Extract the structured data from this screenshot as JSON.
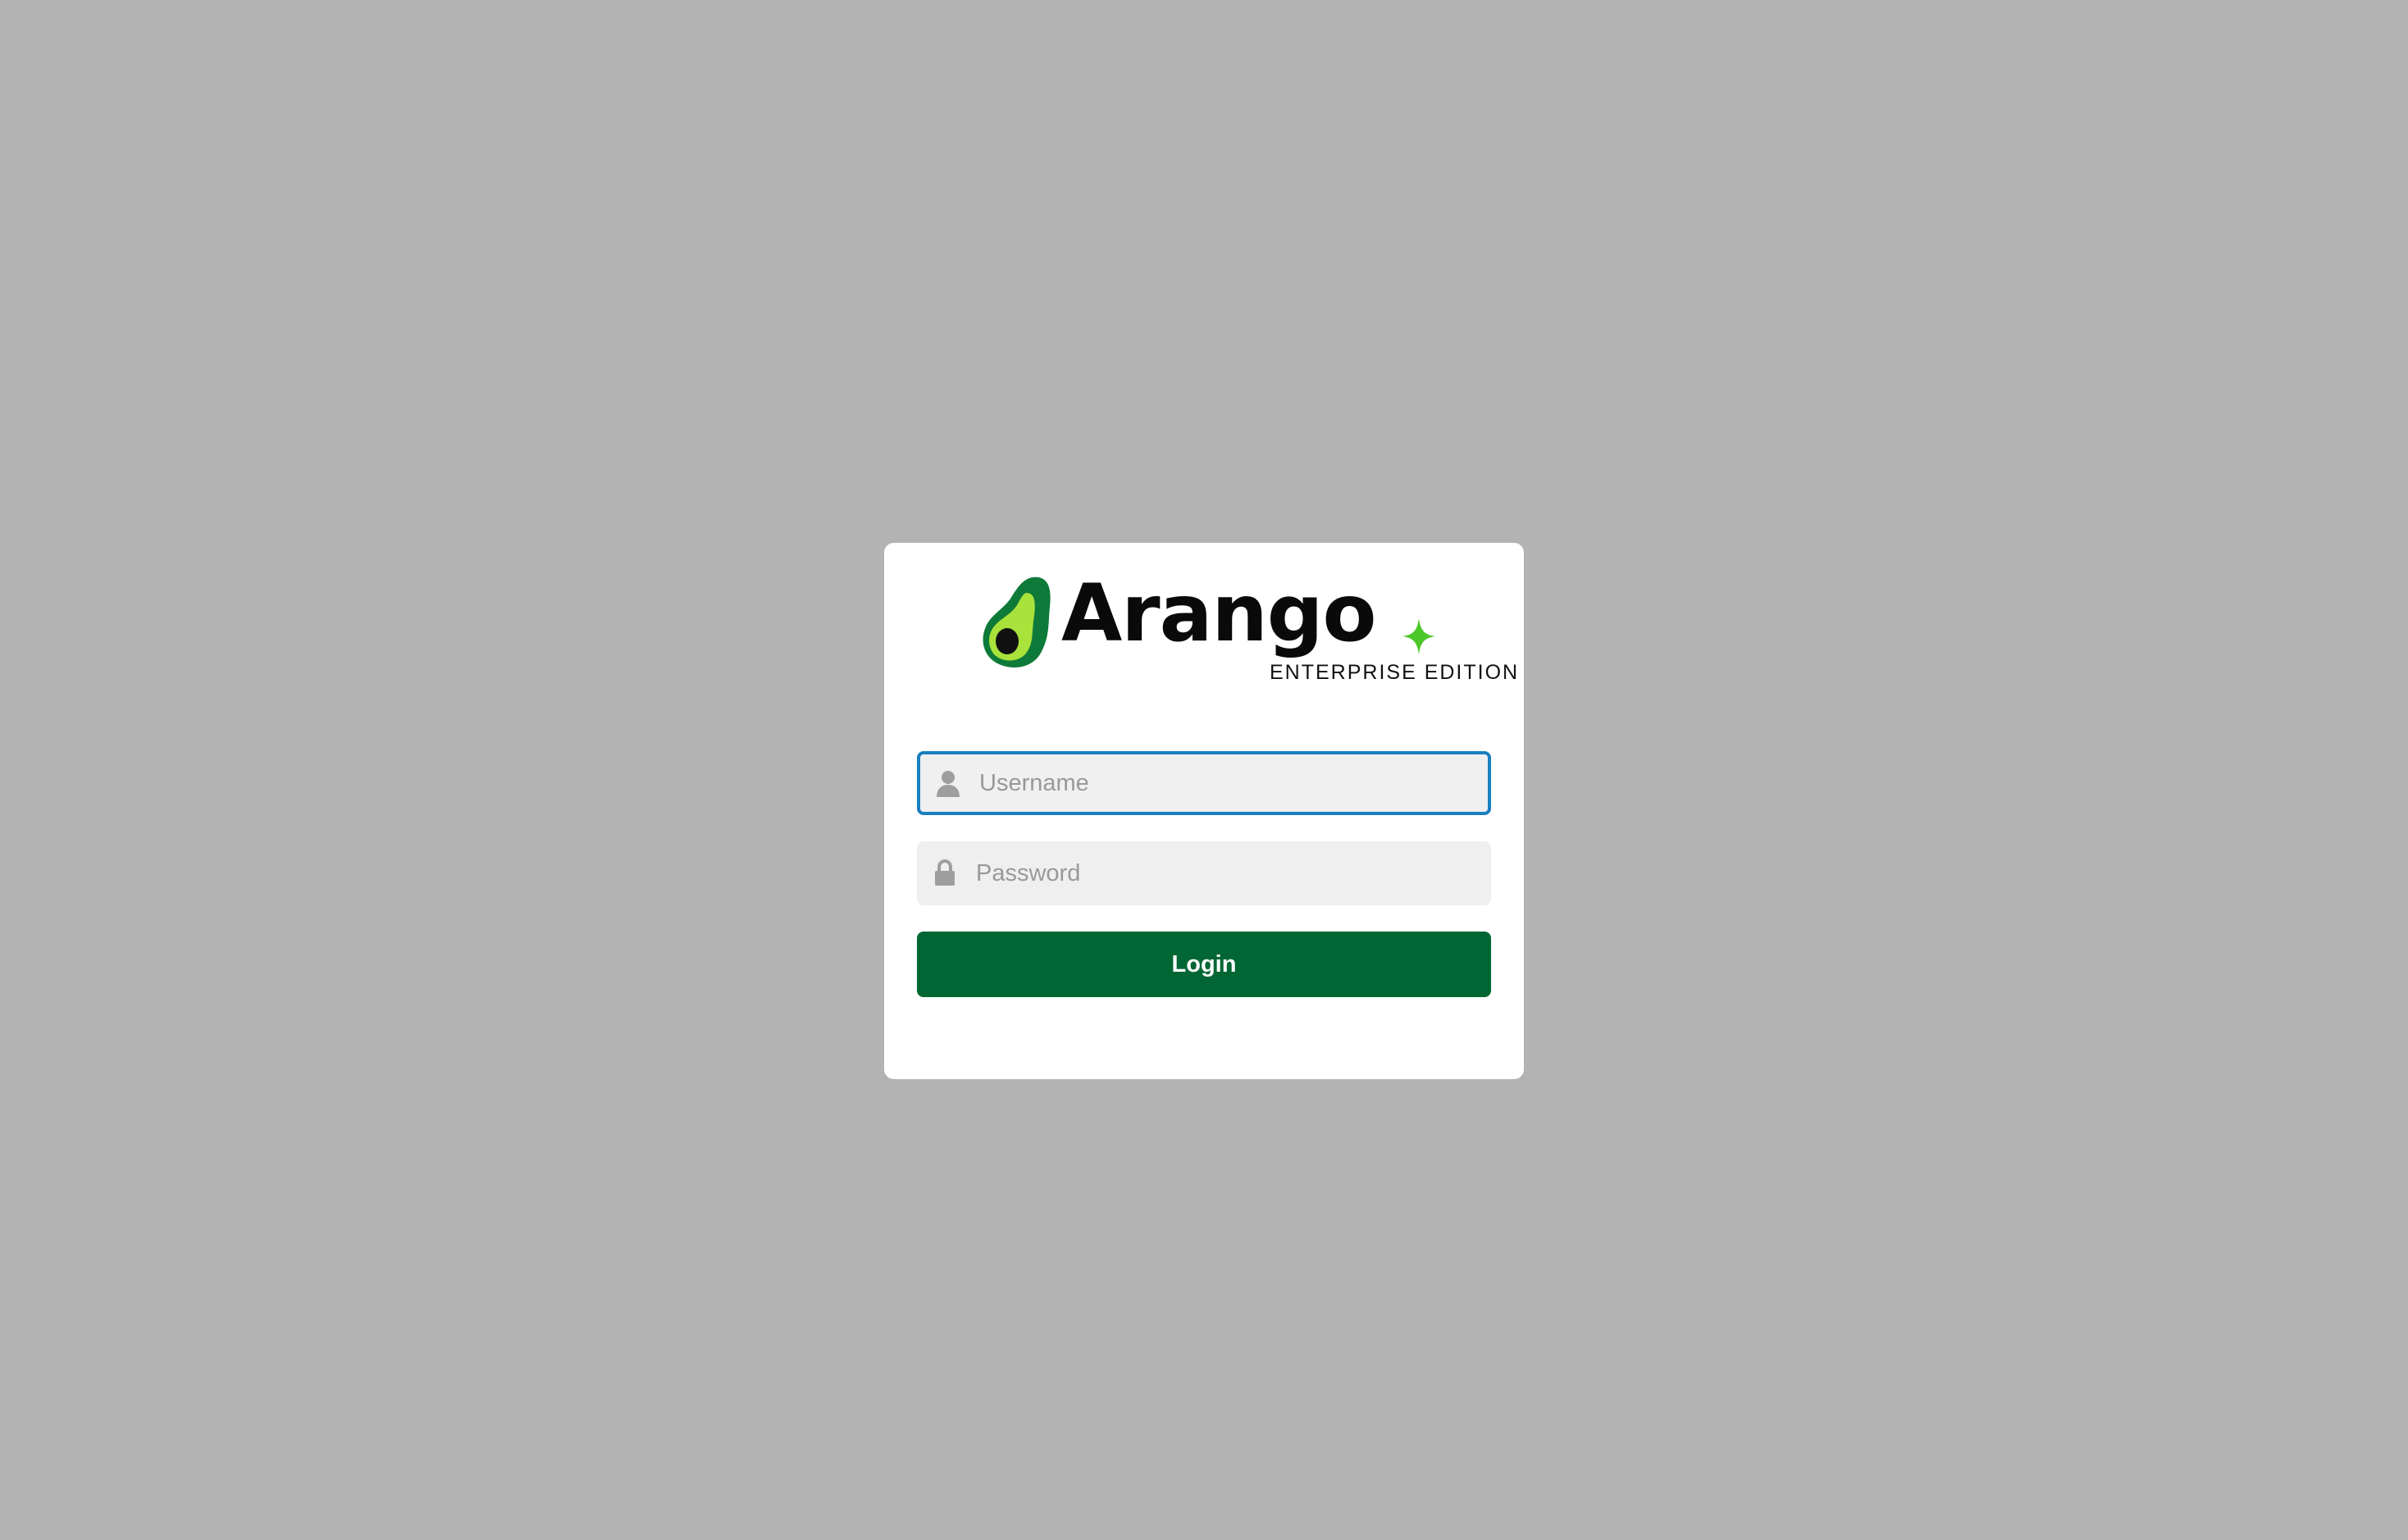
{
  "brand": {
    "name": "Arango",
    "edition": "ENTERPRISE EDITION",
    "logo_icon": "avocado-logo-icon",
    "colors": {
      "avocado_outer": "#0e7a3a",
      "avocado_inner": "#a8e23a",
      "avocado_pit": "#111111",
      "sparkle": "#4cc72a"
    }
  },
  "form": {
    "username": {
      "placeholder": "Username",
      "value": "",
      "icon": "user-icon"
    },
    "password": {
      "placeholder": "Password",
      "value": "",
      "icon": "lock-icon"
    },
    "login_label": "Login"
  },
  "colors": {
    "background": "#b3b3b3",
    "card": "#ffffff",
    "primary_button": "#006633",
    "focus_border": "#1a7fc1",
    "input_bg": "#efefef"
  }
}
